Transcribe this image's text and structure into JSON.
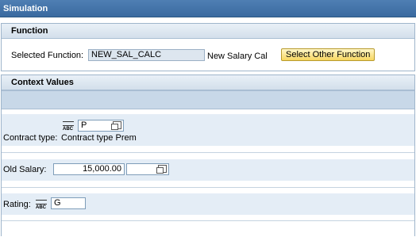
{
  "window": {
    "title": "Simulation"
  },
  "function_panel": {
    "header": "Function",
    "selected_label": "Selected Function:",
    "selected_value": "NEW_SAL_CALC",
    "description": "New Salary Cal",
    "select_button": "Select Other Function"
  },
  "context_panel": {
    "header": "Context Values",
    "contract": {
      "value": "P",
      "label": "Contract type:",
      "text": "Contract type Prem"
    },
    "old_salary": {
      "label": "Old Salary:",
      "value": "15,000.00",
      "currency": ""
    },
    "rating": {
      "label": "Rating:",
      "value": "G"
    }
  },
  "colors": {
    "title_bar": "#3a6aa0",
    "panel_header": "#d3dfeb",
    "button": "#f7d65f",
    "band": "#e4edf6"
  }
}
